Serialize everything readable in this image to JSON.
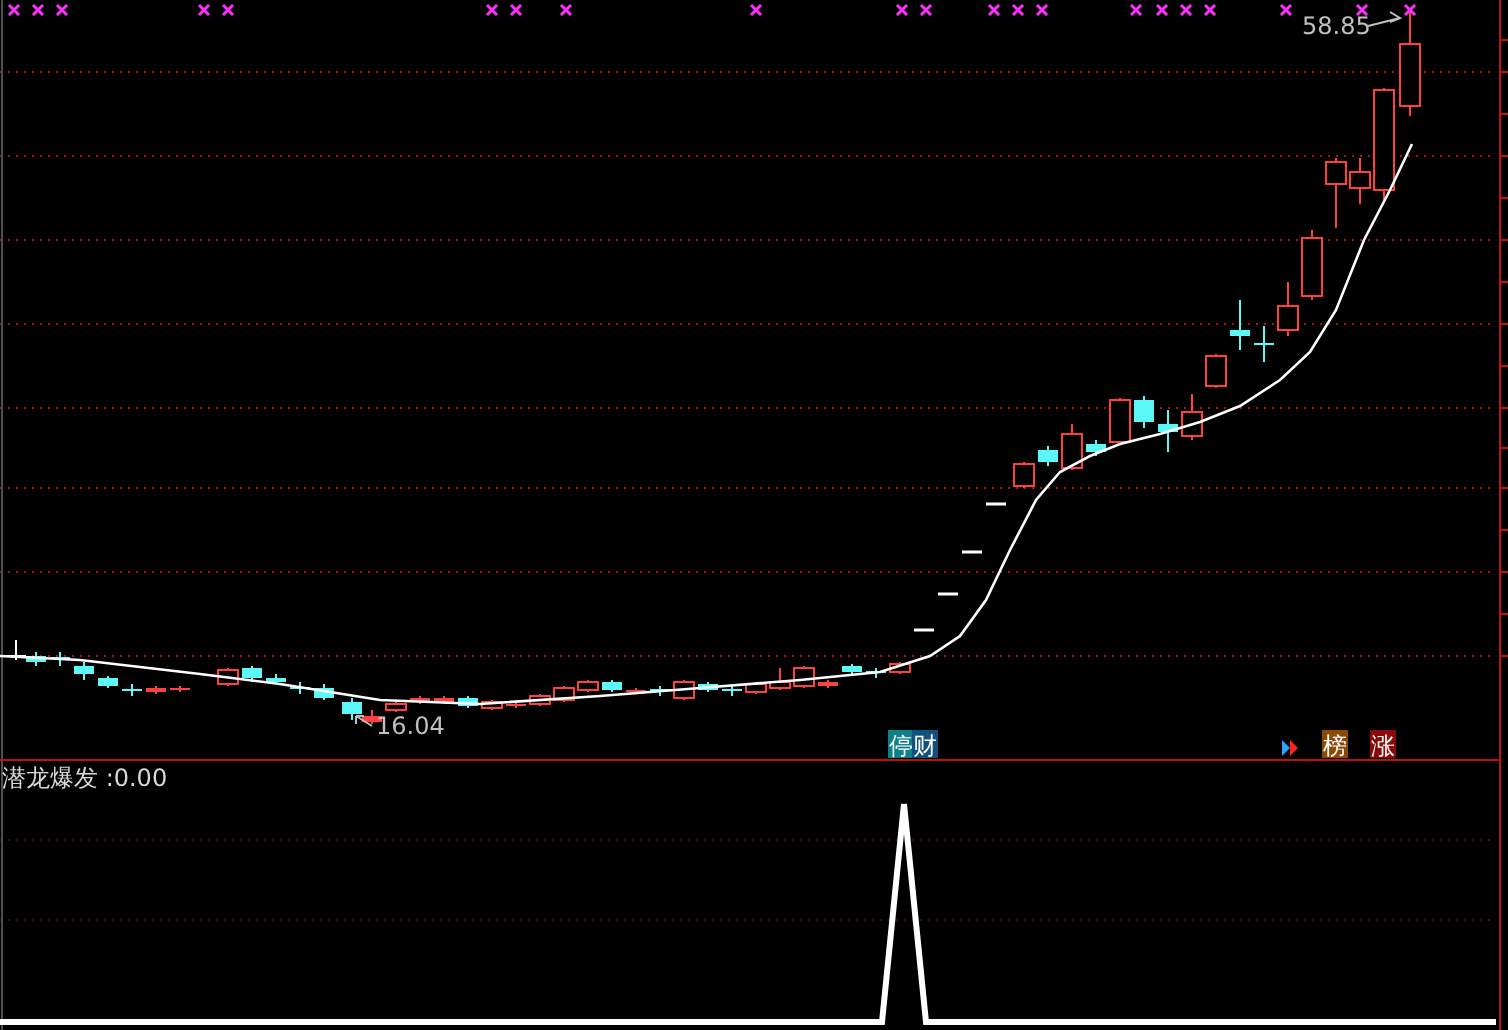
{
  "price_chart": {
    "high_label": "58.85",
    "low_label": "16.04",
    "badges": [
      {
        "text": "停",
        "color": "#0e8088"
      },
      {
        "text": "财",
        "color": "#12507e"
      },
      {
        "text": "榜",
        "color": "#8a4a06"
      },
      {
        "text": "涨",
        "color": "#8a0a0a"
      }
    ]
  },
  "indicator": {
    "label": "潜龙爆发 :0.00"
  }
}
